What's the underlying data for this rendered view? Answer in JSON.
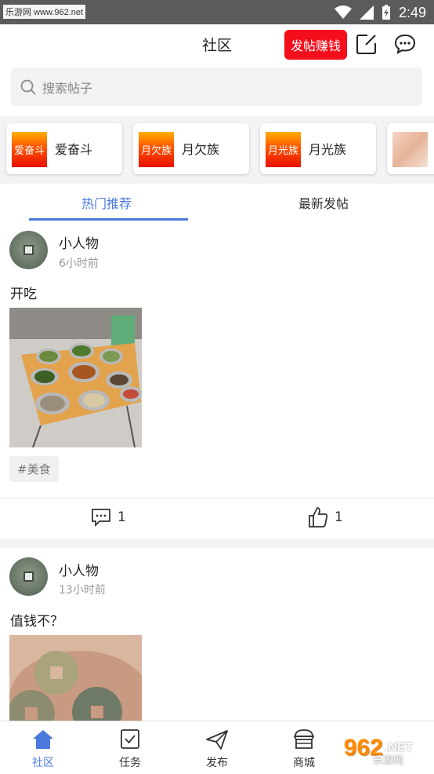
{
  "status_bar": {
    "watermark": "乐游网 www.962.net",
    "time": "2:49"
  },
  "header": {
    "title": "社区",
    "earn_button": "发帖赚钱"
  },
  "search": {
    "placeholder": "搜索帖子"
  },
  "groups": [
    {
      "thumb_text": "爱奋斗",
      "label": "爱奋斗"
    },
    {
      "thumb_text": "月欠族",
      "label": "月欠族"
    },
    {
      "thumb_text": "月光族",
      "label": "月光族"
    }
  ],
  "tabs": [
    {
      "label": "热门推荐",
      "active": true
    },
    {
      "label": "最新发帖",
      "active": false
    }
  ],
  "posts": [
    {
      "user": "小人物",
      "time": "6小时前",
      "text": "开吃",
      "tag": "#美食",
      "comments": "1",
      "likes": "1"
    },
    {
      "user": "小人物",
      "time": "13小时前",
      "text": "值钱不？"
    }
  ],
  "bottom_nav": [
    {
      "label": "社区",
      "icon": "home-icon",
      "active": true
    },
    {
      "label": "任务",
      "icon": "task-icon",
      "active": false
    },
    {
      "label": "发布",
      "icon": "send-icon",
      "active": false
    },
    {
      "label": "商城",
      "icon": "shop-icon",
      "active": false
    }
  ],
  "overlay_watermark": {
    "brand": "962",
    "suffix": ".NET",
    "sub": "乐游网"
  },
  "colors": {
    "accent": "#4a7bdc",
    "earn_button": "#f40d1b",
    "status_bar": "#5b5b5b",
    "page_gray": "#f3f3f5"
  }
}
